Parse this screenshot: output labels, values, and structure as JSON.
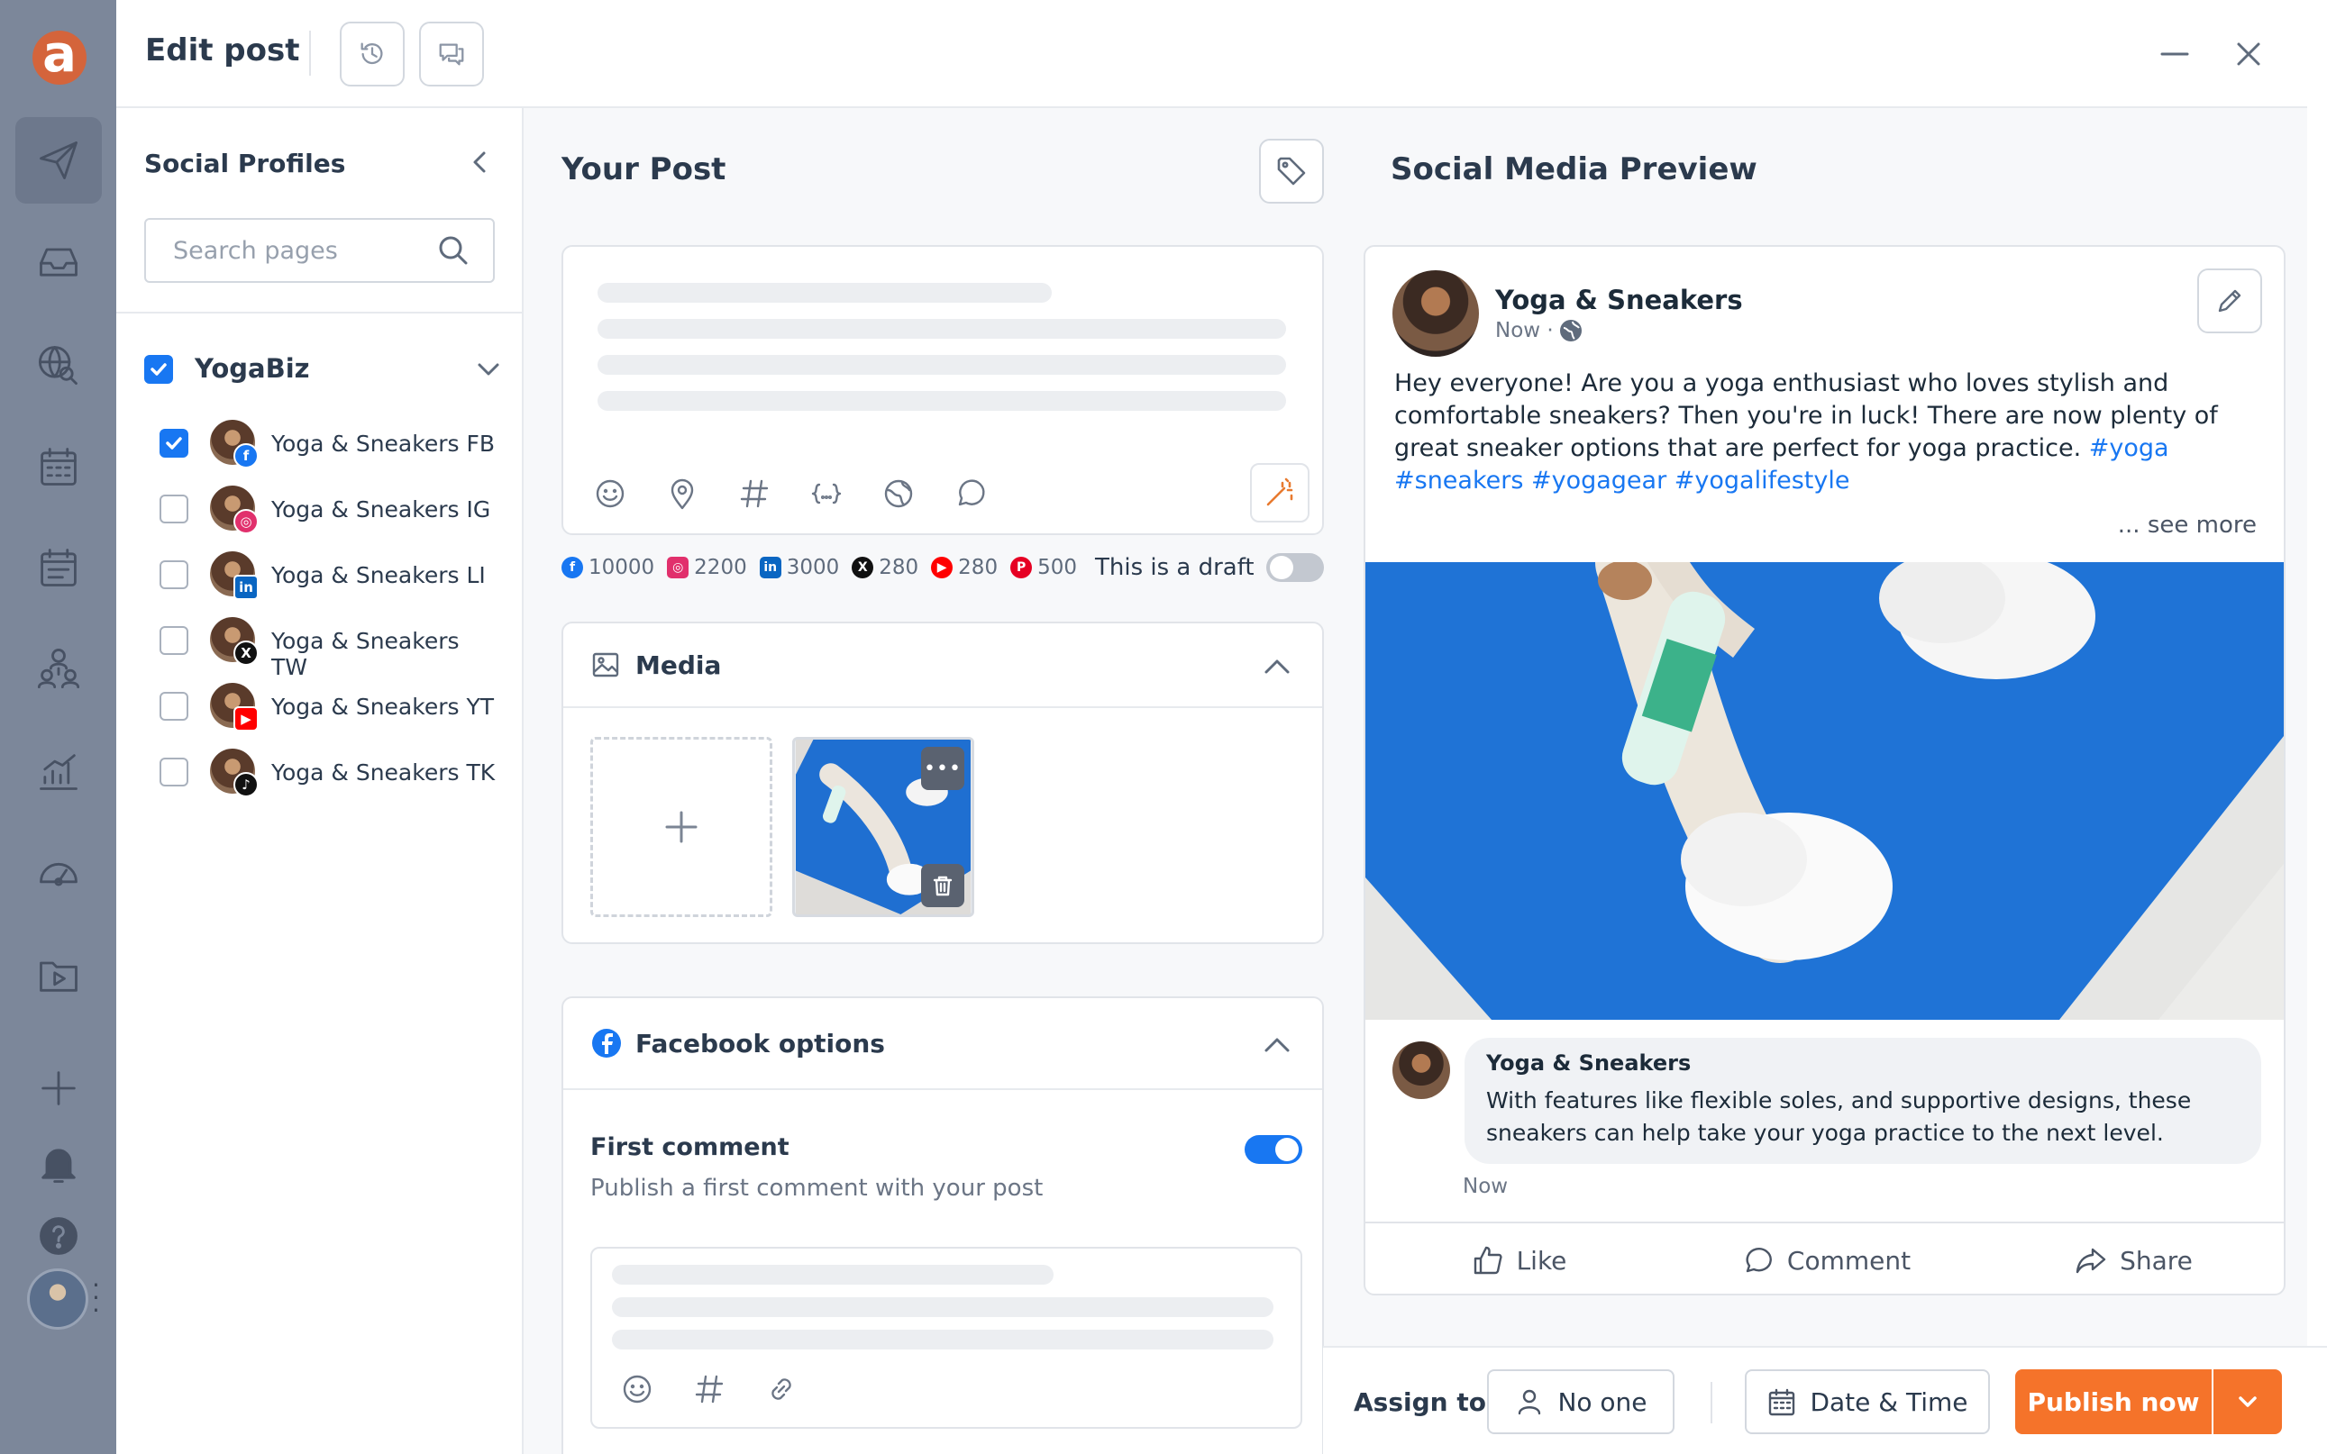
{
  "app": {
    "logo_letter": "a",
    "brand_color": "#d4643b",
    "accent_color": "#1877f2",
    "publish_color": "#f5732a",
    "rail_icons": [
      "send-icon",
      "inbox-icon",
      "search-globe-icon",
      "calendar-icon",
      "planner-icon",
      "team-icon",
      "analytics-icon",
      "dashboard-icon",
      "media-library-icon",
      "add-icon",
      "bell-icon",
      "help-icon"
    ]
  },
  "header": {
    "title": "Edit post",
    "buttons": [
      "history-icon",
      "comments-icon"
    ],
    "window": [
      "minimize-icon",
      "close-icon"
    ]
  },
  "profiles": {
    "title": "Social Profiles",
    "search_placeholder": "Search pages",
    "group": {
      "name": "YogaBiz",
      "checked": true
    },
    "items": [
      {
        "name": "Yoga & Sneakers FB",
        "network": "facebook",
        "checked": true
      },
      {
        "name": "Yoga & Sneakers IG",
        "network": "instagram",
        "checked": false
      },
      {
        "name": "Yoga & Sneakers LI",
        "network": "linkedin",
        "checked": false
      },
      {
        "name": "Yoga & Sneakers TW",
        "network": "x",
        "checked": false
      },
      {
        "name": "Yoga & Sneakers YT",
        "network": "youtube",
        "checked": false
      },
      {
        "name": "Yoga & Sneakers TK",
        "network": "tiktok",
        "checked": false
      }
    ]
  },
  "post": {
    "title": "Your Post",
    "editor_tools": [
      "emoji-icon",
      "location-icon",
      "hashtag-icon",
      "variables-icon",
      "globe-icon",
      "chat-icon"
    ],
    "char_limits": [
      {
        "network": "facebook",
        "count": "10000"
      },
      {
        "network": "instagram",
        "count": "2200"
      },
      {
        "network": "linkedin",
        "count": "3000"
      },
      {
        "network": "x",
        "count": "280"
      },
      {
        "network": "youtube",
        "count": "280"
      },
      {
        "network": "pinterest",
        "count": "500"
      }
    ],
    "draft_label": "This is a draft",
    "draft_on": false
  },
  "media": {
    "title": "Media"
  },
  "facebook_options": {
    "title": "Facebook options",
    "first_comment_title": "First comment",
    "first_comment_sub": "Publish a first comment with your post",
    "first_comment_on": true,
    "comment_tools": [
      "emoji-icon",
      "hashtag-icon",
      "link-icon"
    ]
  },
  "preview": {
    "title": "Social Media Preview",
    "page_name": "Yoga & Sneakers",
    "time": "Now ·",
    "text": "Hey everyone! Are you a yoga enthusiast who loves stylish and comfortable sneakers? Then you're in luck! There are now plenty of great sneaker options that are perfect for yoga practice. ",
    "hashtags": "#yoga #sneakers #yogagear #yogalifestyle",
    "see_more": "... see more",
    "comment": {
      "name": "Yoga & Sneakers",
      "text": "With features like flexible soles, and supportive designs, these sneakers can help take your yoga practice to the next level.",
      "time": "Now"
    },
    "actions": {
      "like": "Like",
      "comment": "Comment",
      "share": "Share"
    }
  },
  "footer": {
    "assign_label": "Assign to",
    "assignee": "No one",
    "date_time": "Date & Time",
    "publish": "Publish now"
  }
}
